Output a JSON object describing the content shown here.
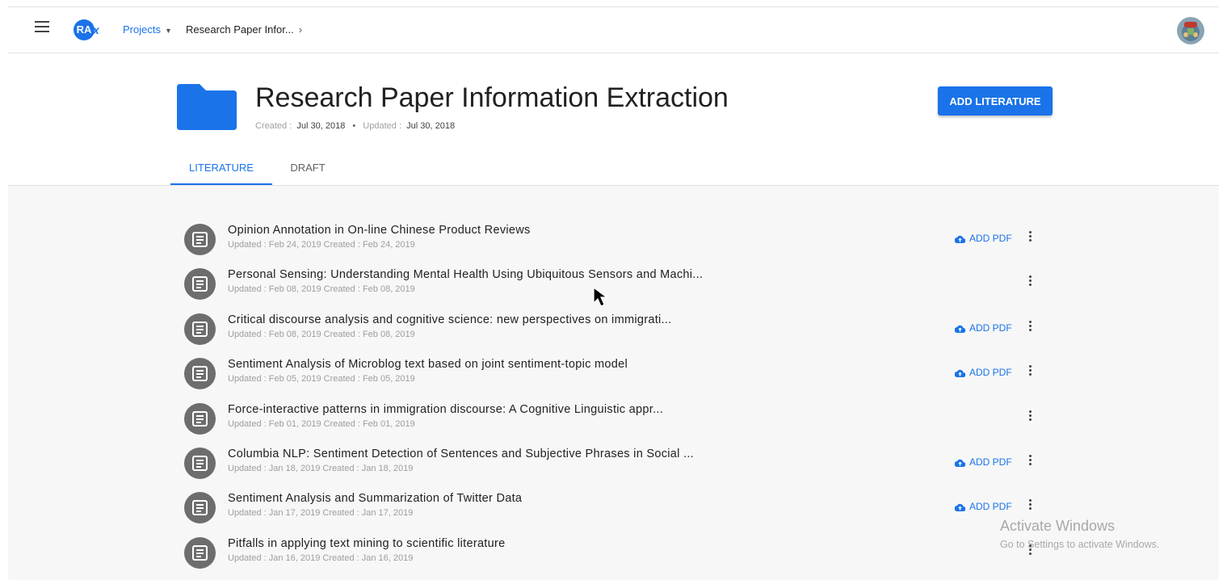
{
  "header": {
    "logo": "RA",
    "logo_suffix": "x",
    "breadcrumb_projects": "Projects",
    "breadcrumb_current": "Research Paper Infor..."
  },
  "project": {
    "title": "Research Paper Information Extraction",
    "created_label": "Created :",
    "created_value": "Jul 30, 2018",
    "updated_label": "Updated :",
    "updated_value": "Jul 30, 2018",
    "add_literature_label": "ADD LITERATURE"
  },
  "tabs": [
    {
      "label": "LITERATURE",
      "active": true
    },
    {
      "label": "DRAFT",
      "active": false
    }
  ],
  "literature": {
    "add_pdf_label": "ADD PDF",
    "items": [
      {
        "title": "Opinion Annotation in On-line Chinese Product Reviews",
        "meta": "Updated :  Feb 24, 2019   Created :  Feb 24, 2019",
        "has_add_pdf": true
      },
      {
        "title": "Personal Sensing: Understanding Mental Health Using Ubiquitous Sensors and Machi...",
        "meta": "Updated :  Feb 08, 2019   Created :  Feb 08, 2019",
        "has_add_pdf": false
      },
      {
        "title": "Critical discourse analysis and cognitive science: new perspectives on immigrati...",
        "meta": "Updated :  Feb 08, 2019   Created :  Feb 08, 2019",
        "has_add_pdf": true
      },
      {
        "title": "Sentiment Analysis of Microblog text based on joint sentiment-topic model",
        "meta": "Updated :  Feb 05, 2019   Created :  Feb 05, 2019",
        "has_add_pdf": true
      },
      {
        "title": "Force-interactive patterns in immigration discourse: A Cognitive Linguistic appr...",
        "meta": "Updated :  Feb 01, 2019   Created :  Feb 01, 2019",
        "has_add_pdf": false
      },
      {
        "title": "Columbia NLP: Sentiment Detection of Sentences and Subjective Phrases in Social ...",
        "meta": "Updated :  Jan 18, 2019   Created :  Jan 18, 2019",
        "has_add_pdf": true
      },
      {
        "title": "Sentiment Analysis and Summarization of Twitter Data",
        "meta": "Updated :  Jan 17, 2019   Created :  Jan 17, 2019",
        "has_add_pdf": true
      },
      {
        "title": "Pitfalls in applying text mining to scientific literature",
        "meta": "Updated :  Jan 16, 2019   Created :  Jan 16, 2019",
        "has_add_pdf": false
      }
    ]
  },
  "watermark": {
    "line1": "Activate Windows",
    "line2": "Go to Settings to activate Windows."
  },
  "colors": {
    "accent": "#1a73e8",
    "list_background": "#f7f7f7",
    "icon_circle": "#6d6d6d"
  }
}
